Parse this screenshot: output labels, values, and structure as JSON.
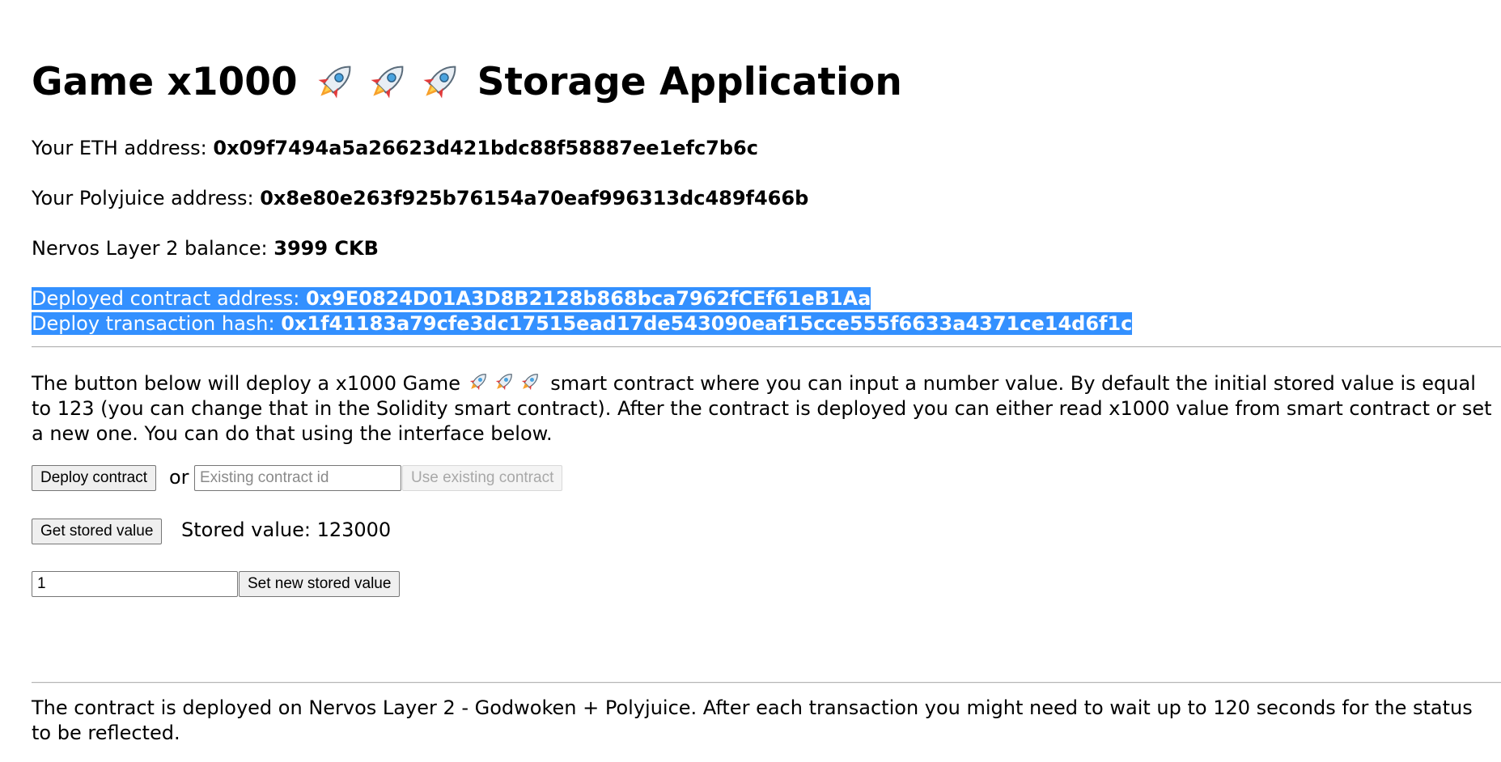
{
  "header": {
    "title_prefix": "Game x1000",
    "title_icons": [
      "rocket-icon",
      "rocket-icon",
      "rocket-icon"
    ],
    "title_suffix": "Storage Application"
  },
  "account": {
    "eth_label": "Your ETH address: ",
    "eth_value": "0x09f7494a5a26623d421bdc88f58887ee1efc7b6c",
    "polyjuice_label": "Your Polyjuice address: ",
    "polyjuice_value": "0x8e80e263f925b76154a70eaf996313dc489f466b",
    "balance_label": "Nervos Layer 2 balance: ",
    "balance_value": "3999 CKB"
  },
  "deployment": {
    "address_label": "Deployed contract address: ",
    "address_value": "0x9E0824D01A3D8B2128b868bca7962fCEf61eB1Aa",
    "hash_label": "Deploy transaction hash: ",
    "hash_value": "0x1f41183a79cfe3dc17515ead17de543090eaf15cce555f6633a4371ce14d6f1c",
    "highlight_color": "#3390ff"
  },
  "intro": {
    "text_before": "The button below will deploy a x1000 Game ",
    "text_icons": [
      "rocket-icon",
      "rocket-icon",
      "rocket-icon"
    ],
    "text_after": " smart contract where you can input a number value. By default the initial stored value is equal to 123 (you can change that in the Solidity smart contract). After the contract is deployed you can either read x1000 value from smart contract or set a new one. You can do that using the interface below."
  },
  "controls": {
    "deploy_label": "Deploy contract",
    "or_label": "or",
    "existing_placeholder": "Existing contract id",
    "existing_value": "",
    "use_existing_label": "Use existing contract",
    "get_label": "Get stored value",
    "stored_text": "Stored value: 123000",
    "set_input_value": "1",
    "set_label": "Set new stored value"
  },
  "footer": {
    "text": "The contract is deployed on Nervos Layer 2 - Godwoken + Polyjuice. After each transaction you might need to wait up to 120 seconds for the status to be reflected."
  }
}
